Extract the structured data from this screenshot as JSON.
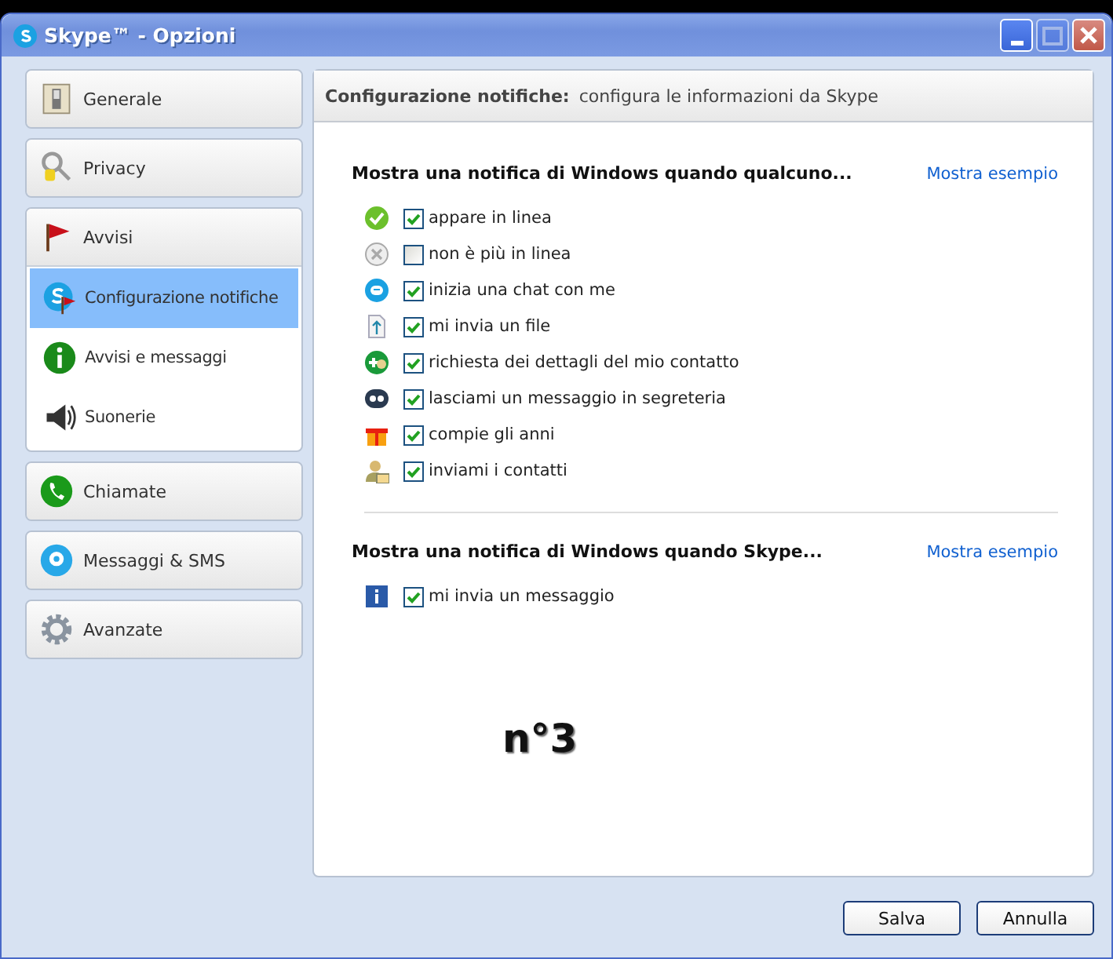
{
  "window": {
    "title": "Skype™ - Opzioni"
  },
  "sidebar": {
    "items": [
      {
        "label": "Generale",
        "selected": false
      },
      {
        "label": "Privacy",
        "selected": false
      },
      {
        "label": "Avvisi",
        "selected": false,
        "expanded": true,
        "children": [
          {
            "label": "Configurazione notifiche",
            "selected": true
          },
          {
            "label": "Avvisi e messaggi",
            "selected": false
          },
          {
            "label": "Suonerie",
            "selected": false
          }
        ]
      },
      {
        "label": "Chiamate",
        "selected": false
      },
      {
        "label": "Messaggi & SMS",
        "selected": false
      },
      {
        "label": "Avanzate",
        "selected": false
      }
    ]
  },
  "header": {
    "title": "Configurazione notifiche:",
    "subtitle": "configura le informazioni da Skype"
  },
  "sections": [
    {
      "title": "Mostra una notifica di Windows quando qualcuno...",
      "link": "Mostra esempio",
      "items": [
        {
          "label": "appare in linea",
          "checked": true
        },
        {
          "label": "non è più in linea",
          "checked": false
        },
        {
          "label": "inizia una chat con me",
          "checked": true
        },
        {
          "label": "mi invia un file",
          "checked": true
        },
        {
          "label": "richiesta dei dettagli del mio contatto",
          "checked": true
        },
        {
          "label": "lasciami un messaggio in segreteria",
          "checked": true
        },
        {
          "label": "compie gli anni",
          "checked": true
        },
        {
          "label": "inviami i contatti",
          "checked": true
        }
      ]
    },
    {
      "title": "Mostra una notifica di Windows quando Skype...",
      "link": "Mostra esempio",
      "items": [
        {
          "label": "mi invia un messaggio",
          "checked": true
        }
      ]
    }
  ],
  "annotation": "n°3",
  "buttons": [
    "Salva",
    "Annulla"
  ]
}
